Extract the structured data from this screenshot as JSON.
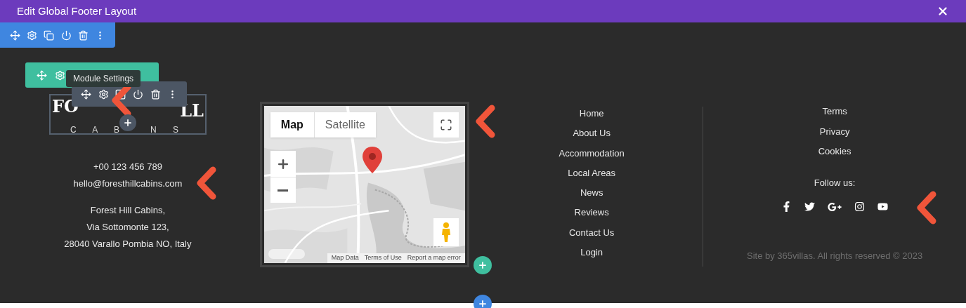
{
  "window": {
    "title": "Edit Global Footer Layout"
  },
  "tooltip": "Module Settings",
  "logo": {
    "left": "FO",
    "right": "LL",
    "sub_left": "C A B",
    "sub_right": "N S"
  },
  "contact": {
    "phone": "+00 123 456 789",
    "email": "hello@foresthillcabins.com",
    "address": [
      "Forest Hill Cabins,",
      "Via Sottomonte 123,",
      "28040 Varallo Pombia NO, Italy"
    ]
  },
  "map": {
    "type_buttons": [
      {
        "label": "Map",
        "selected": true
      },
      {
        "label": "Satellite",
        "selected": false
      }
    ],
    "attribution": [
      "Map Data",
      "Terms of Use",
      "Report a map error"
    ]
  },
  "nav_links": [
    "Home",
    "About Us",
    "Accommodation",
    "Local Areas",
    "News",
    "Reviews",
    "Contact Us",
    "Login"
  ],
  "legal_links": [
    "Terms",
    "Privacy",
    "Cookies"
  ],
  "social": {
    "heading": "Follow us:",
    "networks": [
      {
        "kind": "facebook"
      },
      {
        "kind": "twitter"
      },
      {
        "kind": "googleplus"
      },
      {
        "kind": "instagram"
      },
      {
        "kind": "youtube"
      }
    ]
  },
  "copyright": "Site by 365villas. All rights reserved © 2023"
}
